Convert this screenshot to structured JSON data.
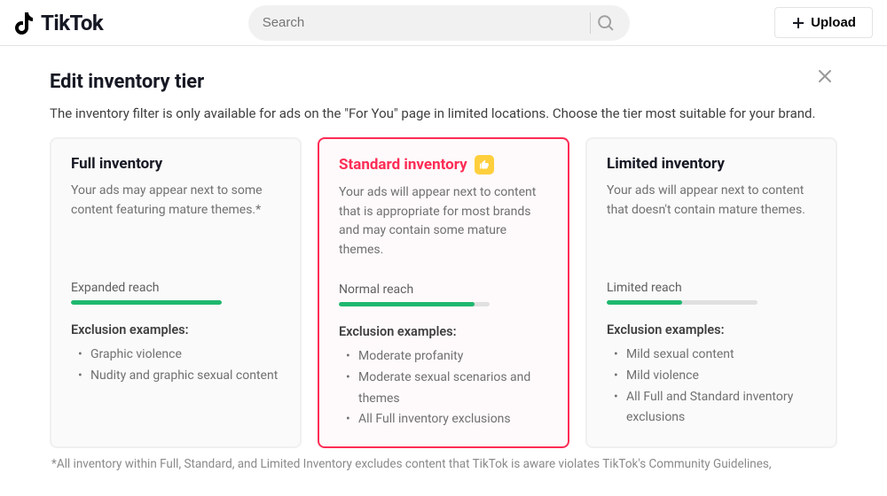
{
  "header": {
    "brand": "TikTok",
    "search_placeholder": "Search",
    "upload_label": "Upload"
  },
  "modal": {
    "title": "Edit inventory tier",
    "subtitle": "The inventory filter is only available for ads on the \"For You\" page in limited locations. Choose the tier most suitable for your brand.",
    "footnote": "*All inventory within Full, Standard, and Limited Inventory excludes content that TikTok is aware violates TikTok's Community Guidelines,"
  },
  "tiers": [
    {
      "id": "full",
      "title": "Full inventory",
      "selected": false,
      "recommended": false,
      "description": "Your ads may appear next to some content featuring mature themes.*",
      "reach_label": "Expanded reach",
      "reach_pct": 100,
      "exclusion_title": "Exclusion examples:",
      "exclusions": [
        "Graphic violence",
        "Nudity and graphic sexual content"
      ]
    },
    {
      "id": "standard",
      "title": "Standard inventory",
      "selected": true,
      "recommended": true,
      "description": "Your ads will appear next to content that is appropriate for most brands and may contain some mature themes.",
      "reach_label": "Normal reach",
      "reach_pct": 90,
      "exclusion_title": "Exclusion examples:",
      "exclusions": [
        "Moderate profanity",
        "Moderate sexual scenarios and themes",
        "All Full inventory exclusions"
      ]
    },
    {
      "id": "limited",
      "title": "Limited inventory",
      "selected": false,
      "recommended": false,
      "description": "Your ads will appear next to content that doesn't contain mature themes.",
      "reach_label": "Limited reach",
      "reach_pct": 50,
      "exclusion_title": "Exclusion examples:",
      "exclusions": [
        "Mild sexual content",
        "Mild violence",
        "All Full and Standard inventory exclusions"
      ]
    }
  ]
}
